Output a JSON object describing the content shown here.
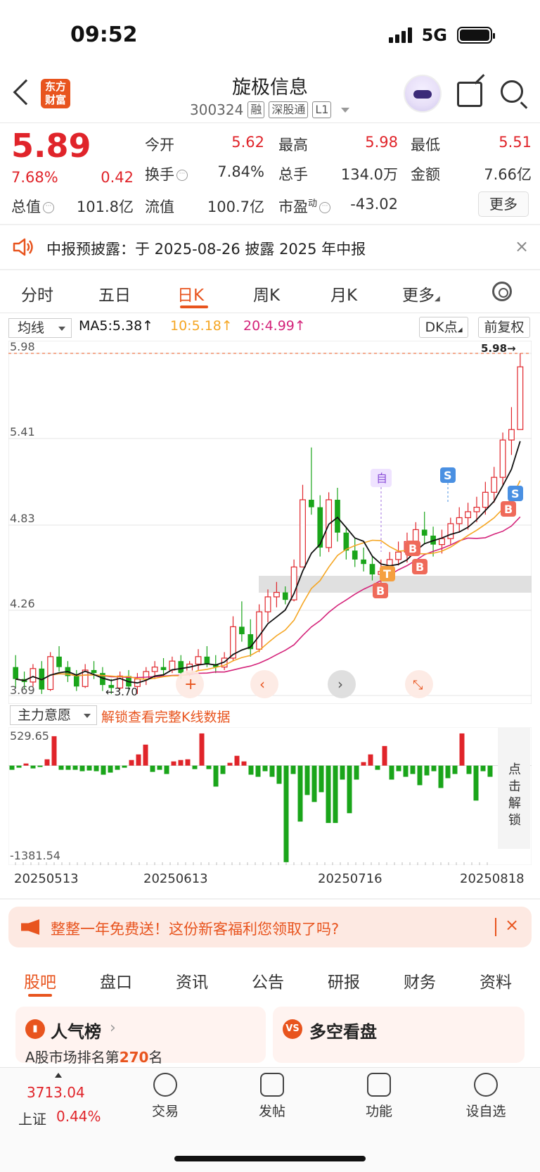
{
  "status": {
    "time": "09:52",
    "network": "5G"
  },
  "header": {
    "logo": "东方财富",
    "stock_name": "旋极信息",
    "code": "300324",
    "tags": [
      "融",
      "深股通",
      "L1"
    ]
  },
  "quote": {
    "price": "5.89",
    "change_pct": "7.68%",
    "change_amt": "0.42",
    "rows": [
      [
        {
          "label": "今开",
          "value": "5.62",
          "color": "red"
        },
        {
          "label": "最高",
          "value": "5.98",
          "color": "red"
        },
        {
          "label": "最低",
          "value": "5.51",
          "color": "red"
        }
      ],
      [
        {
          "label": "换手",
          "value": "7.84%",
          "color": "dark"
        },
        {
          "label": "总手",
          "value": "134.0万",
          "color": "dark"
        },
        {
          "label": "金额",
          "value": "7.66亿",
          "color": "dark"
        }
      ],
      [
        {
          "label": "流值",
          "value": "100.7亿",
          "color": "dark"
        },
        {
          "label": "市盈",
          "value": "-43.02",
          "color": "dark"
        }
      ]
    ],
    "total_cap_label": "总值",
    "total_cap": "101.8亿",
    "pe_sup": "动",
    "more_label": "更多"
  },
  "notice": {
    "text": "中报预披露：于 2025-08-26 披露 2025 年中报",
    "close": "×"
  },
  "ktabs": [
    "分时",
    "五日",
    "日K",
    "周K",
    "月K",
    "更多"
  ],
  "ma": {
    "select": "均线",
    "ma5": "MA5:5.38↑",
    "ma10": "10:5.18↑",
    "ma20": "20:4.99↑",
    "ma5_color": "#111111",
    "ma10_color": "#f5a623",
    "ma20_color": "#d4237a",
    "dk_label": "DK点",
    "fq_label": "前复权"
  },
  "colors": {
    "up": "#e0242a",
    "down": "#1aa51a",
    "accent": "#e8541e"
  },
  "chart_data": [
    {
      "type": "candlestick",
      "ylim": [
        3.69,
        5.98
      ],
      "yticks": [
        "5.98",
        "5.41",
        "4.83",
        "4.26",
        "3.69"
      ],
      "max_label": "5.98→",
      "min_label": "←3.70",
      "candles": [
        [
          3.88,
          3.96,
          3.74,
          3.8
        ],
        [
          3.8,
          3.85,
          3.73,
          3.78
        ],
        [
          3.78,
          3.9,
          3.75,
          3.87
        ],
        [
          3.87,
          3.92,
          3.7,
          3.73
        ],
        [
          3.73,
          3.98,
          3.72,
          3.95
        ],
        [
          3.95,
          4.02,
          3.85,
          3.88
        ],
        [
          3.88,
          3.92,
          3.78,
          3.82
        ],
        [
          3.82,
          3.86,
          3.72,
          3.75
        ],
        [
          3.75,
          3.9,
          3.74,
          3.86
        ],
        [
          3.86,
          3.92,
          3.8,
          3.84
        ],
        [
          3.84,
          3.88,
          3.72,
          3.76
        ],
        [
          3.76,
          3.8,
          3.7,
          3.74
        ],
        [
          3.74,
          3.85,
          3.73,
          3.82
        ],
        [
          3.82,
          3.86,
          3.73,
          3.75
        ],
        [
          3.75,
          3.84,
          3.7,
          3.8
        ],
        [
          3.8,
          3.88,
          3.76,
          3.85
        ],
        [
          3.85,
          3.92,
          3.8,
          3.88
        ],
        [
          3.88,
          3.94,
          3.82,
          3.86
        ],
        [
          3.86,
          3.95,
          3.84,
          3.92
        ],
        [
          3.92,
          3.96,
          3.8,
          3.84
        ],
        [
          3.84,
          3.92,
          3.82,
          3.9
        ],
        [
          3.9,
          4.0,
          3.86,
          3.95
        ],
        [
          3.95,
          4.02,
          3.88,
          3.9
        ],
        [
          3.9,
          3.96,
          3.84,
          3.88
        ],
        [
          3.88,
          3.98,
          3.86,
          3.94
        ],
        [
          3.94,
          4.22,
          3.92,
          4.15
        ],
        [
          4.15,
          4.32,
          4.05,
          4.1
        ],
        [
          4.1,
          4.2,
          3.95,
          4.0
        ],
        [
          4.0,
          4.3,
          3.98,
          4.25
        ],
        [
          4.25,
          4.4,
          4.18,
          4.35
        ],
        [
          4.35,
          4.45,
          4.28,
          4.38
        ],
        [
          4.38,
          4.42,
          4.3,
          4.33
        ],
        [
          4.33,
          4.6,
          4.32,
          4.55
        ],
        [
          4.55,
          5.1,
          4.55,
          5.0
        ],
        [
          5.0,
          5.35,
          4.9,
          4.95
        ],
        [
          4.95,
          5.03,
          4.62,
          4.68
        ],
        [
          4.68,
          5.05,
          4.65,
          5.0
        ],
        [
          5.0,
          5.08,
          4.72,
          4.78
        ],
        [
          4.78,
          4.82,
          4.6,
          4.66
        ],
        [
          4.66,
          4.74,
          4.55,
          4.6
        ],
        [
          4.6,
          4.68,
          4.52,
          4.57
        ],
        [
          4.57,
          4.62,
          4.46,
          4.5
        ],
        [
          4.5,
          4.6,
          4.4,
          4.52
        ],
        [
          4.52,
          4.65,
          4.48,
          4.6
        ],
        [
          4.6,
          4.72,
          4.56,
          4.65
        ],
        [
          4.65,
          4.78,
          4.58,
          4.72
        ],
        [
          4.72,
          4.85,
          4.65,
          4.8
        ],
        [
          4.8,
          4.92,
          4.7,
          4.76
        ],
        [
          4.76,
          4.82,
          4.62,
          4.7
        ],
        [
          4.7,
          4.8,
          4.64,
          4.74
        ],
        [
          4.74,
          4.88,
          4.7,
          4.84
        ],
        [
          4.84,
          4.95,
          4.78,
          4.88
        ],
        [
          4.88,
          4.98,
          4.8,
          4.92
        ],
        [
          4.92,
          5.02,
          4.85,
          4.95
        ],
        [
          4.95,
          5.12,
          4.9,
          5.05
        ],
        [
          5.05,
          5.22,
          4.98,
          5.15
        ],
        [
          5.15,
          5.45,
          5.1,
          5.4
        ],
        [
          5.4,
          5.62,
          5.3,
          5.47
        ],
        [
          5.47,
          5.98,
          5.51,
          5.89
        ]
      ]
    },
    {
      "type": "bar",
      "title": "主力意愿",
      "ylim": [
        -1381.54,
        529.65
      ],
      "yticks": [
        "529.65",
        "-1381.54"
      ],
      "x_tick_labels": [
        "20250513",
        "20250613",
        "20250716",
        "20250818"
      ],
      "values": [
        -60,
        -30,
        30,
        -40,
        -20,
        90,
        420,
        -60,
        -60,
        -60,
        -80,
        -70,
        -80,
        -130,
        -100,
        -60,
        -30,
        80,
        160,
        300,
        -90,
        -60,
        -120,
        60,
        80,
        90,
        -50,
        460,
        -50,
        -300,
        -120,
        40,
        140,
        60,
        -130,
        -160,
        -80,
        -160,
        -260,
        -1380,
        -120,
        -800,
        -420,
        -520,
        -380,
        -820,
        -820,
        -200,
        -680,
        -200,
        50,
        160,
        -60,
        280,
        -200,
        -80,
        -160,
        -120,
        -280,
        -140,
        -80,
        -320,
        -180,
        -120,
        460,
        -120,
        -500,
        -80,
        -160
      ]
    }
  ],
  "indicator": {
    "select": "主力意愿",
    "unlock": "解锁查看完整K线数据",
    "side": "点击解锁"
  },
  "promo": {
    "text": "整整一年免费送！这份新客福利您领取了吗?",
    "close": "×"
  },
  "btabs": [
    "股吧",
    "盘口",
    "资讯",
    "公告",
    "研报",
    "财务",
    "资料"
  ],
  "cards": {
    "popularity": "人气榜",
    "rank_prefix": "A股市场排名第",
    "rank": "270",
    "rank_suffix": "名",
    "vs": "多空看盘"
  },
  "bottom_nav": {
    "index_val": "3713.04",
    "index_name": "上证",
    "index_pct": "0.44%",
    "items": [
      "交易",
      "发帖",
      "功能",
      "设自选"
    ]
  }
}
